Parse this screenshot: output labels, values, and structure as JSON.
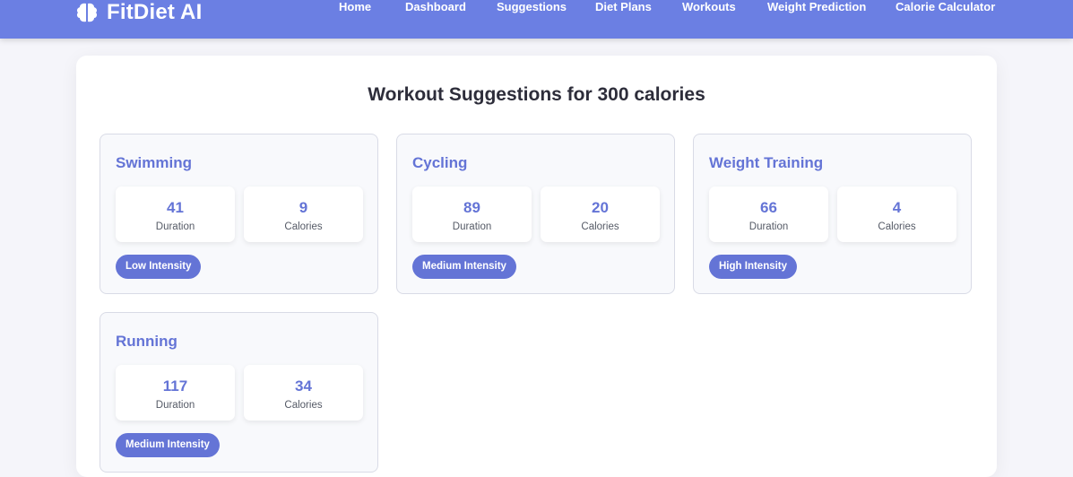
{
  "app": {
    "brand": "FitDiet AI",
    "brand_icon": "brain-icon",
    "accent_color": "#6b7fe3"
  },
  "nav": {
    "items": [
      {
        "label": "Home"
      },
      {
        "label": "Dashboard"
      },
      {
        "label": "Suggestions"
      },
      {
        "label": "Diet Plans"
      },
      {
        "label": "Workouts"
      },
      {
        "label": "Weight Prediction"
      },
      {
        "label": "Calorie Calculator"
      }
    ]
  },
  "page": {
    "title": "Workout Suggestions for 300 calories"
  },
  "workouts": [
    {
      "name": "Swimming",
      "duration": "41",
      "duration_label": "Duration",
      "calories": "9",
      "calories_label": "Calories",
      "intensity": "Low Intensity"
    },
    {
      "name": "Cycling",
      "duration": "89",
      "duration_label": "Duration",
      "calories": "20",
      "calories_label": "Calories",
      "intensity": "Medium Intensity"
    },
    {
      "name": "Weight Training",
      "duration": "66",
      "duration_label": "Duration",
      "calories": "4",
      "calories_label": "Calories",
      "intensity": "High Intensity"
    },
    {
      "name": "Running",
      "duration": "117",
      "duration_label": "Duration",
      "calories": "34",
      "calories_label": "Calories",
      "intensity": "Medium Intensity"
    }
  ]
}
